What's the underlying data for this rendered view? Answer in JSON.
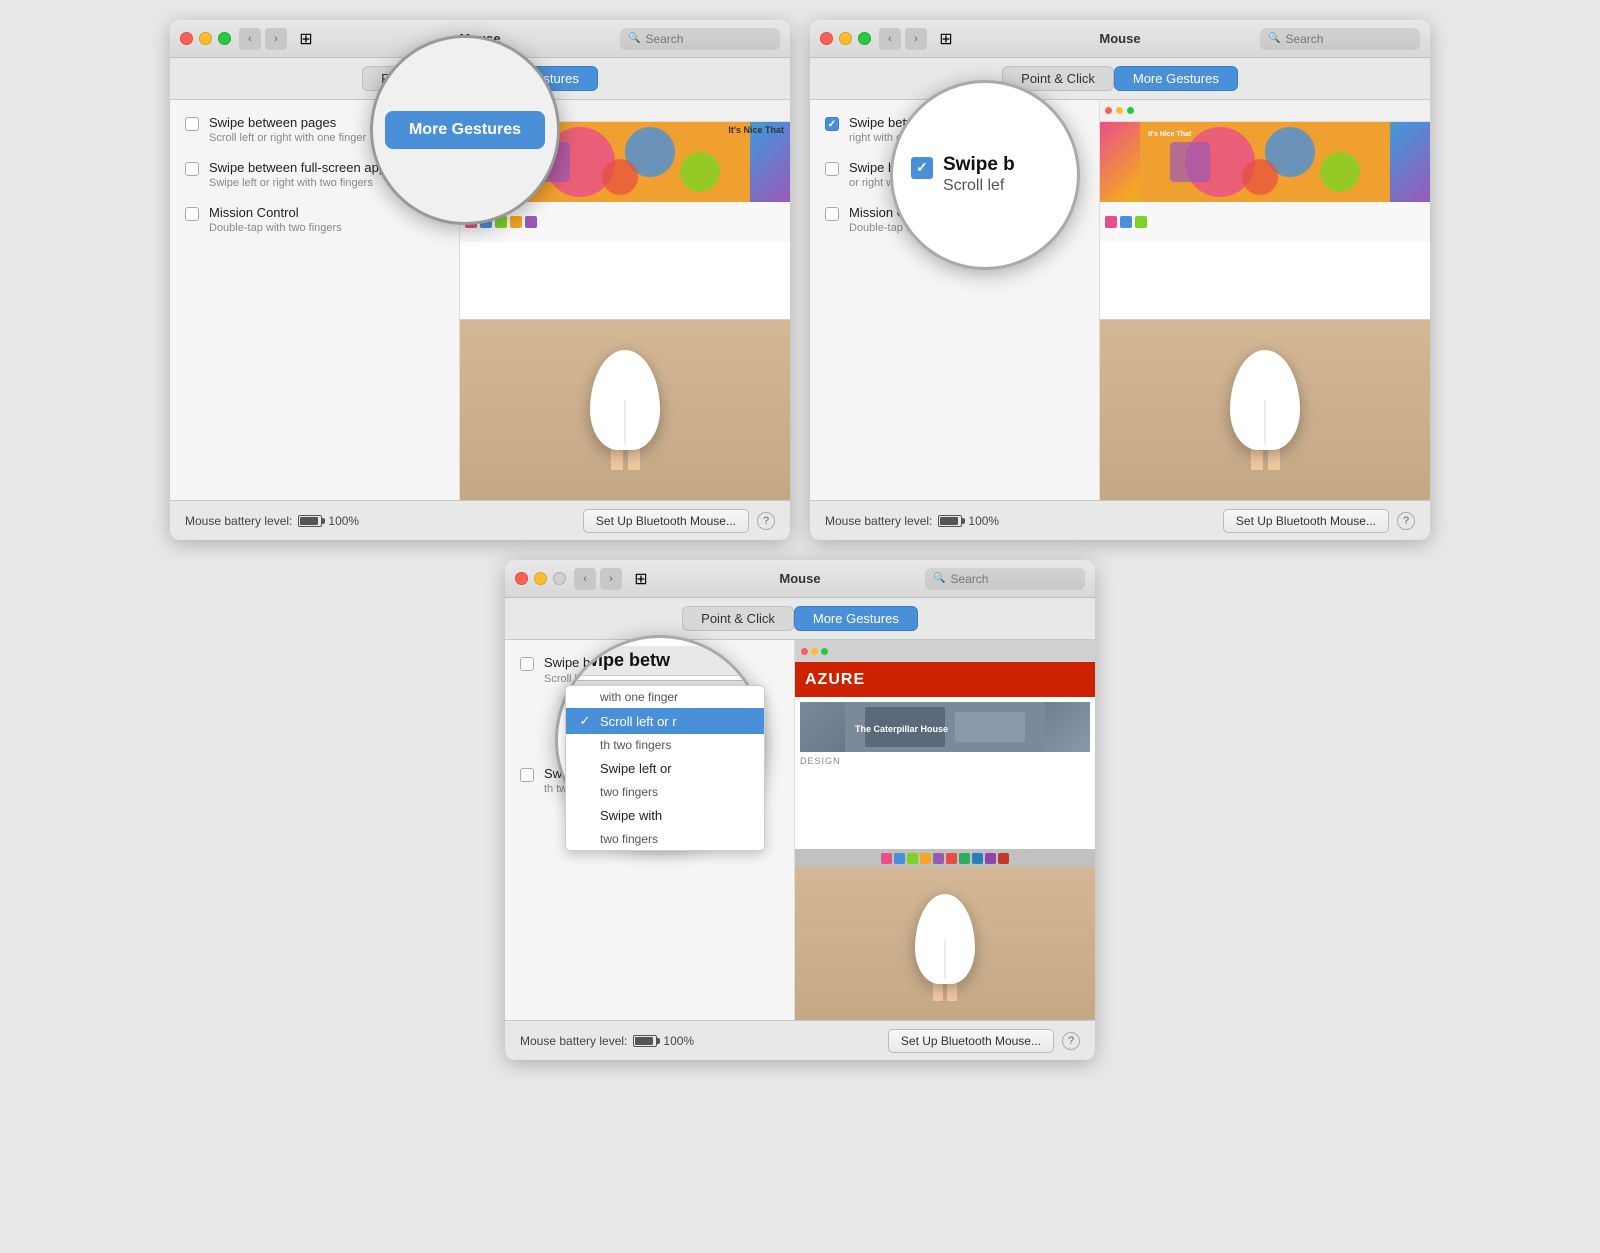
{
  "windows": {
    "window1": {
      "title": "Mouse",
      "tabs": [
        "Point & Click",
        "More Gestures"
      ],
      "active_tab": "More Gestures",
      "search_placeholder": "Search",
      "gestures": [
        {
          "label": "Swipe between pages",
          "sublabel": "Scroll left or right with one finger",
          "checked": false,
          "has_dropdown": true
        },
        {
          "label": "Swipe between full-screen apps",
          "sublabel": "Swipe left or right with two fingers",
          "checked": false,
          "has_dropdown": false
        },
        {
          "label": "Mission Control",
          "sublabel": "Double-tap with two fingers",
          "checked": false,
          "has_dropdown": false
        }
      ],
      "magnifier_label": "More Gestures",
      "battery_label": "Mouse battery level:",
      "battery_pct": "100%",
      "setup_btn": "Set Up Bluetooth Mouse...",
      "help_btn": "?"
    },
    "window2": {
      "title": "Mouse",
      "tabs": [
        "Point & Click",
        "More Gestures"
      ],
      "active_tab": "More Gestures",
      "search_placeholder": "Search",
      "gestures": [
        {
          "label": "Swipe between pages",
          "sublabel": "right with one finger",
          "checked": true,
          "has_dropdown": true
        },
        {
          "label": "Swipe between full-screen apps",
          "sublabel": "or right with two fingers",
          "checked": false,
          "has_dropdown": false
        },
        {
          "label": "Mission Control",
          "sublabel": "Double-tap with two fingers",
          "checked": false,
          "has_dropdown": false
        }
      ],
      "magnifier": {
        "title": "Swipe b",
        "subtitle": "Scroll lef"
      },
      "battery_label": "Mouse battery level:",
      "battery_pct": "100%",
      "setup_btn": "Set Up Bluetooth Mouse...",
      "help_btn": "?"
    },
    "window3": {
      "title": "Mouse",
      "tabs": [
        "Point & Click",
        "More Gestures"
      ],
      "active_tab": "More Gestures",
      "search_placeholder": "Search",
      "magnifier": {
        "header": "Swipe betw",
        "subheader": "Scroll left or rig",
        "dropdown_label": "Scroll left or ri",
        "dropdown_arrow": "▼",
        "options": [
          {
            "label": "Scroll left or r",
            "selected": true,
            "sublabel": "th one finger"
          },
          {
            "label": "Swipe left or",
            "selected": false,
            "sublabel": "th two fingers"
          },
          {
            "label": "Swipe with",
            "selected": false,
            "sublabel": "two fingers"
          }
        ]
      },
      "gestures": [
        {
          "label": "Swipe between pages",
          "sublabel": "Scroll left or right",
          "checked": false,
          "has_dropdown": true,
          "dropdown_value": "one finger"
        },
        {
          "label": "Swipe between full-screen apps",
          "sublabel": "th two fingers",
          "checked": false,
          "has_dropdown": false
        }
      ],
      "battery_label": "Mouse battery level:",
      "battery_pct": "100%",
      "setup_btn": "Set Up Bluetooth Mouse...",
      "help_btn": "?"
    }
  },
  "labels": {
    "point_click": "Point & Click",
    "more_gestures": "More Gestures",
    "search": "Search",
    "battery": "Mouse battery level:",
    "battery_pct": "100%",
    "setup": "Set Up Bluetooth Mouse...",
    "help": "?",
    "swipe_pages": "Swipe between pages",
    "swipe_pages_sub": "Scroll left or right with one finger",
    "swipe_fullscreen": "Swipe between full-screen apps",
    "swipe_fullscreen_sub": "Swipe left or right with two fingers",
    "mission_control": "Mission Control",
    "mission_control_sub": "Double-tap with two fingers",
    "scroll_left_right": "Scroll left or right",
    "scroll_one_finger": "Scroll left or right with one finger",
    "swipe_two_fingers": "Swipe left or right with two fingers",
    "swipe_with_two": "Swipe with two fingers"
  }
}
